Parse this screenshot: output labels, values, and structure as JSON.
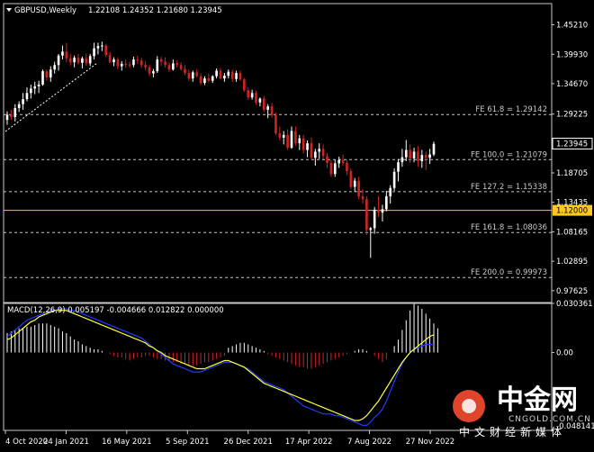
{
  "header": {
    "symbol": "GBPUSD,Weekly",
    "ohlc": "1.22108 1.24352 1.21680 1.23945"
  },
  "colors": {
    "background": "#000000",
    "bull": "#ffffff",
    "bear": "#d22323",
    "fib_line": "#c8c8c8",
    "support_line": "#ffc81e",
    "macd_hist_pos": "#ffffff",
    "macd_hist_neg": "#d22323",
    "macd_line": "#1e3cff",
    "signal_line": "#ffff3c",
    "watermark_logo": "#e0442b"
  },
  "price_axis": {
    "ticks": [
      "1.45210",
      "1.39930",
      "1.34670",
      "1.29225",
      "1.23945",
      "1.18705",
      "1.13435",
      "1.12000",
      "1.08165",
      "1.02895",
      "0.97625"
    ],
    "current_price": "1.23945",
    "support_price": "1.12000"
  },
  "time_axis": {
    "labels": [
      "4 Oct 2020",
      "24 Jan 2021",
      "16 May 2021",
      "5 Sep 2021",
      "26 Dec 2021",
      "17 Apr 2022",
      "7 Aug 2022",
      "27 Nov 2022"
    ]
  },
  "fib_levels": [
    {
      "label": "FE 61.8 = 1.29142",
      "price": 1.29142
    },
    {
      "label": "FE 100.0 = 1.21079",
      "price": 1.21079
    },
    {
      "label": "FE 127.2 = 1.15338",
      "price": 1.15338
    },
    {
      "label": "FE 161.8 = 1.08036",
      "price": 1.08036
    },
    {
      "label": "FE 200.0 = 0.99973",
      "price": 0.99973
    }
  ],
  "support_level": {
    "price": 1.12
  },
  "macd": {
    "header": "MACD(12,26,9) 0.005197 -0.004666 0.012822 0.000000",
    "axis_ticks": [
      "0.030361",
      "0.00",
      "-0.048141"
    ]
  },
  "watermark": {
    "brand_cn": "中金网",
    "domain": "CNGOLD.COM.CN",
    "tagline_cn": "中文财经新媒体"
  },
  "chart_data": {
    "type": "candlestick",
    "title": "GBPUSD,Weekly",
    "ylim": [
      0.955,
      1.49
    ],
    "x_labels": [
      "4 Oct 2020",
      "24 Jan 2021",
      "16 May 2021",
      "5 Sep 2021",
      "26 Dec 2021",
      "17 Apr 2022",
      "7 Aug 2022",
      "27 Nov 2022"
    ],
    "candles": [
      [
        1.282,
        1.297,
        1.273,
        1.291
      ],
      [
        1.291,
        1.3,
        1.282,
        1.287
      ],
      [
        1.287,
        1.31,
        1.279,
        1.303
      ],
      [
        1.303,
        1.315,
        1.296,
        1.31
      ],
      [
        1.31,
        1.33,
        1.3,
        1.319
      ],
      [
        1.319,
        1.34,
        1.315,
        1.33
      ],
      [
        1.33,
        1.345,
        1.32,
        1.338
      ],
      [
        1.338,
        1.35,
        1.328,
        1.342
      ],
      [
        1.342,
        1.352,
        1.33,
        1.345
      ],
      [
        1.345,
        1.372,
        1.343,
        1.369
      ],
      [
        1.369,
        1.372,
        1.352,
        1.358
      ],
      [
        1.358,
        1.378,
        1.35,
        1.372
      ],
      [
        1.372,
        1.386,
        1.365,
        1.38
      ],
      [
        1.38,
        1.4,
        1.37,
        1.397
      ],
      [
        1.397,
        1.415,
        1.39,
        1.404
      ],
      [
        1.404,
        1.42,
        1.385,
        1.392
      ],
      [
        1.392,
        1.4,
        1.379,
        1.385
      ],
      [
        1.385,
        1.397,
        1.376,
        1.393
      ],
      [
        1.393,
        1.4,
        1.381,
        1.384
      ],
      [
        1.384,
        1.395,
        1.374,
        1.392
      ],
      [
        1.392,
        1.401,
        1.379,
        1.383
      ],
      [
        1.383,
        1.4,
        1.378,
        1.396
      ],
      [
        1.396,
        1.42,
        1.39,
        1.41
      ],
      [
        1.41,
        1.42,
        1.399,
        1.414
      ],
      [
        1.414,
        1.422,
        1.405,
        1.415
      ],
      [
        1.415,
        1.418,
        1.394,
        1.398
      ],
      [
        1.398,
        1.404,
        1.383,
        1.385
      ],
      [
        1.385,
        1.394,
        1.378,
        1.39
      ],
      [
        1.39,
        1.394,
        1.372,
        1.378
      ],
      [
        1.378,
        1.387,
        1.37,
        1.382
      ],
      [
        1.382,
        1.39,
        1.375,
        1.381
      ],
      [
        1.381,
        1.386,
        1.375,
        1.38
      ],
      [
        1.38,
        1.395,
        1.376,
        1.39
      ],
      [
        1.39,
        1.397,
        1.382,
        1.388
      ],
      [
        1.388,
        1.393,
        1.375,
        1.38
      ],
      [
        1.38,
        1.387,
        1.37,
        1.376
      ],
      [
        1.376,
        1.38,
        1.36,
        1.365
      ],
      [
        1.365,
        1.373,
        1.358,
        1.369
      ],
      [
        1.369,
        1.396,
        1.366,
        1.39
      ],
      [
        1.39,
        1.395,
        1.379,
        1.386
      ],
      [
        1.386,
        1.394,
        1.376,
        1.38
      ],
      [
        1.38,
        1.385,
        1.368,
        1.372
      ],
      [
        1.372,
        1.39,
        1.37,
        1.383
      ],
      [
        1.383,
        1.389,
        1.376,
        1.38
      ],
      [
        1.38,
        1.385,
        1.37,
        1.373
      ],
      [
        1.373,
        1.38,
        1.362,
        1.366
      ],
      [
        1.366,
        1.372,
        1.352,
        1.356
      ],
      [
        1.356,
        1.37,
        1.35,
        1.367
      ],
      [
        1.367,
        1.372,
        1.358,
        1.36
      ],
      [
        1.36,
        1.365,
        1.344,
        1.348
      ],
      [
        1.348,
        1.36,
        1.344,
        1.356
      ],
      [
        1.356,
        1.365,
        1.349,
        1.352
      ],
      [
        1.352,
        1.362,
        1.348,
        1.36
      ],
      [
        1.36,
        1.374,
        1.356,
        1.37
      ],
      [
        1.37,
        1.375,
        1.354,
        1.356
      ],
      [
        1.356,
        1.366,
        1.35,
        1.361
      ],
      [
        1.361,
        1.372,
        1.356,
        1.368
      ],
      [
        1.368,
        1.372,
        1.35,
        1.355
      ],
      [
        1.355,
        1.37,
        1.35,
        1.366
      ],
      [
        1.366,
        1.37,
        1.352,
        1.354
      ],
      [
        1.354,
        1.357,
        1.332,
        1.335
      ],
      [
        1.335,
        1.34,
        1.318,
        1.322
      ],
      [
        1.322,
        1.336,
        1.318,
        1.33
      ],
      [
        1.33,
        1.334,
        1.309,
        1.313
      ],
      [
        1.313,
        1.322,
        1.306,
        1.32
      ],
      [
        1.32,
        1.325,
        1.296,
        1.3
      ],
      [
        1.3,
        1.31,
        1.285,
        1.306
      ],
      [
        1.306,
        1.312,
        1.286,
        1.29
      ],
      [
        1.29,
        1.295,
        1.255,
        1.258
      ],
      [
        1.258,
        1.27,
        1.245,
        1.25
      ],
      [
        1.25,
        1.262,
        1.238,
        1.255
      ],
      [
        1.255,
        1.265,
        1.228,
        1.232
      ],
      [
        1.232,
        1.27,
        1.23,
        1.262
      ],
      [
        1.262,
        1.27,
        1.235,
        1.24
      ],
      [
        1.24,
        1.255,
        1.228,
        1.249
      ],
      [
        1.249,
        1.255,
        1.222,
        1.228
      ],
      [
        1.228,
        1.245,
        1.215,
        1.24
      ],
      [
        1.24,
        1.25,
        1.21,
        1.214
      ],
      [
        1.214,
        1.23,
        1.2,
        1.225
      ],
      [
        1.225,
        1.24,
        1.212,
        1.23
      ],
      [
        1.23,
        1.238,
        1.212,
        1.217
      ],
      [
        1.217,
        1.222,
        1.196,
        1.205
      ],
      [
        1.205,
        1.21,
        1.18,
        1.185
      ],
      [
        1.185,
        1.21,
        1.18,
        1.204
      ],
      [
        1.204,
        1.216,
        1.196,
        1.21
      ],
      [
        1.21,
        1.22,
        1.2,
        1.205
      ],
      [
        1.205,
        1.21,
        1.183,
        1.19
      ],
      [
        1.19,
        1.195,
        1.158,
        1.162
      ],
      [
        1.162,
        1.178,
        1.153,
        1.173
      ],
      [
        1.173,
        1.18,
        1.14,
        1.145
      ],
      [
        1.145,
        1.158,
        1.132,
        1.14
      ],
      [
        1.14,
        1.145,
        1.076,
        1.085
      ],
      [
        1.085,
        1.09,
        1.035,
        1.088
      ],
      [
        1.088,
        1.126,
        1.078,
        1.121
      ],
      [
        1.121,
        1.146,
        1.108,
        1.116
      ],
      [
        1.116,
        1.13,
        1.1,
        1.122
      ],
      [
        1.122,
        1.155,
        1.118,
        1.145
      ],
      [
        1.145,
        1.165,
        1.132,
        1.16
      ],
      [
        1.16,
        1.195,
        1.155,
        1.189
      ],
      [
        1.189,
        1.212,
        1.172,
        1.206
      ],
      [
        1.206,
        1.23,
        1.198,
        1.215
      ],
      [
        1.215,
        1.246,
        1.208,
        1.228
      ],
      [
        1.228,
        1.238,
        1.205,
        1.213
      ],
      [
        1.213,
        1.232,
        1.206,
        1.225
      ],
      [
        1.225,
        1.235,
        1.198,
        1.208
      ],
      [
        1.208,
        1.228,
        1.196,
        1.219
      ],
      [
        1.219,
        1.225,
        1.192,
        1.214
      ],
      [
        1.214,
        1.23,
        1.203,
        1.22
      ],
      [
        1.22,
        1.243,
        1.217,
        1.239
      ]
    ],
    "macd_histogram": [
      0.012,
      0.013,
      0.014,
      0.015,
      0.015,
      0.016,
      0.016,
      0.017,
      0.018,
      0.018,
      0.018,
      0.017,
      0.016,
      0.015,
      0.013,
      0.012,
      0.01,
      0.008,
      0.007,
      0.005,
      0.004,
      0.003,
      0.002,
      0.002,
      0.001,
      0.0,
      -0.001,
      -0.002,
      -0.003,
      -0.003,
      -0.004,
      -0.005,
      -0.004,
      -0.003,
      -0.003,
      -0.002,
      -0.002,
      -0.003,
      -0.004,
      -0.004,
      -0.005,
      -0.005,
      -0.006,
      -0.006,
      -0.007,
      -0.007,
      -0.008,
      -0.008,
      -0.008,
      -0.007,
      -0.006,
      -0.006,
      -0.005,
      -0.004,
      -0.003,
      -0.002,
      0.003,
      0.004,
      0.005,
      0.006,
      0.006,
      0.005,
      0.004,
      0.003,
      0.002,
      0.001,
      -0.001,
      -0.002,
      -0.003,
      -0.004,
      -0.005,
      -0.006,
      -0.007,
      -0.008,
      -0.009,
      -0.009,
      -0.01,
      -0.01,
      -0.009,
      -0.008,
      -0.007,
      -0.006,
      -0.005,
      -0.004,
      -0.003,
      -0.002,
      -0.001,
      0.0,
      0.001,
      0.002,
      0.002,
      0.001,
      0.0,
      -0.002,
      -0.004,
      -0.006,
      -0.004,
      0.0,
      0.004,
      0.008,
      0.014,
      0.02,
      0.026,
      0.03,
      0.029,
      0.027,
      0.024,
      0.021,
      0.018,
      0.015
    ],
    "macd_line": [
      0.01,
      0.012,
      0.014,
      0.016,
      0.018,
      0.02,
      0.021,
      0.022,
      0.023,
      0.024,
      0.025,
      0.026,
      0.026,
      0.027,
      0.027,
      0.027,
      0.026,
      0.026,
      0.025,
      0.024,
      0.023,
      0.022,
      0.021,
      0.02,
      0.019,
      0.018,
      0.017,
      0.016,
      0.015,
      0.014,
      0.013,
      0.012,
      0.011,
      0.01,
      0.009,
      0.007,
      0.005,
      0.003,
      0.001,
      -0.001,
      -0.003,
      -0.005,
      -0.007,
      -0.008,
      -0.009,
      -0.01,
      -0.011,
      -0.012,
      -0.012,
      -0.012,
      -0.011,
      -0.01,
      -0.009,
      -0.008,
      -0.007,
      -0.006,
      -0.006,
      -0.006,
      -0.007,
      -0.008,
      -0.009,
      -0.01,
      -0.012,
      -0.014,
      -0.016,
      -0.018,
      -0.019,
      -0.02,
      -0.021,
      -0.022,
      -0.023,
      -0.025,
      -0.027,
      -0.029,
      -0.031,
      -0.033,
      -0.034,
      -0.035,
      -0.036,
      -0.037,
      -0.038,
      -0.038,
      -0.038,
      -0.039,
      -0.039,
      -0.04,
      -0.041,
      -0.042,
      -0.043,
      -0.044,
      -0.045,
      -0.045,
      -0.043,
      -0.04,
      -0.038,
      -0.035,
      -0.03,
      -0.024,
      -0.018,
      -0.012,
      -0.007,
      -0.003,
      0.0,
      0.002,
      0.003,
      0.004,
      0.005,
      0.005,
      0.005
    ],
    "signal_line": [
      0.008,
      0.009,
      0.011,
      0.013,
      0.015,
      0.017,
      0.019,
      0.02,
      0.022,
      0.023,
      0.024,
      0.025,
      0.026,
      0.026,
      0.026,
      0.026,
      0.025,
      0.024,
      0.023,
      0.022,
      0.021,
      0.02,
      0.019,
      0.018,
      0.017,
      0.016,
      0.015,
      0.014,
      0.013,
      0.012,
      0.011,
      0.01,
      0.009,
      0.008,
      0.007,
      0.006,
      0.004,
      0.003,
      0.001,
      0.0,
      -0.002,
      -0.003,
      -0.004,
      -0.005,
      -0.006,
      -0.007,
      -0.008,
      -0.009,
      -0.01,
      -0.01,
      -0.01,
      -0.009,
      -0.008,
      -0.007,
      -0.006,
      -0.005,
      -0.005,
      -0.006,
      -0.007,
      -0.008,
      -0.009,
      -0.011,
      -0.013,
      -0.015,
      -0.017,
      -0.019,
      -0.02,
      -0.021,
      -0.022,
      -0.023,
      -0.024,
      -0.025,
      -0.026,
      -0.027,
      -0.028,
      -0.029,
      -0.03,
      -0.031,
      -0.032,
      -0.033,
      -0.034,
      -0.035,
      -0.036,
      -0.037,
      -0.038,
      -0.039,
      -0.04,
      -0.041,
      -0.042,
      -0.042,
      -0.041,
      -0.039,
      -0.036,
      -0.033,
      -0.03,
      -0.026,
      -0.022,
      -0.018,
      -0.014,
      -0.01,
      -0.006,
      -0.003,
      0.0,
      0.002,
      0.004,
      0.006,
      0.008,
      0.01,
      0.011
    ],
    "macd_ylim": [
      -0.048141,
      0.030361
    ]
  }
}
